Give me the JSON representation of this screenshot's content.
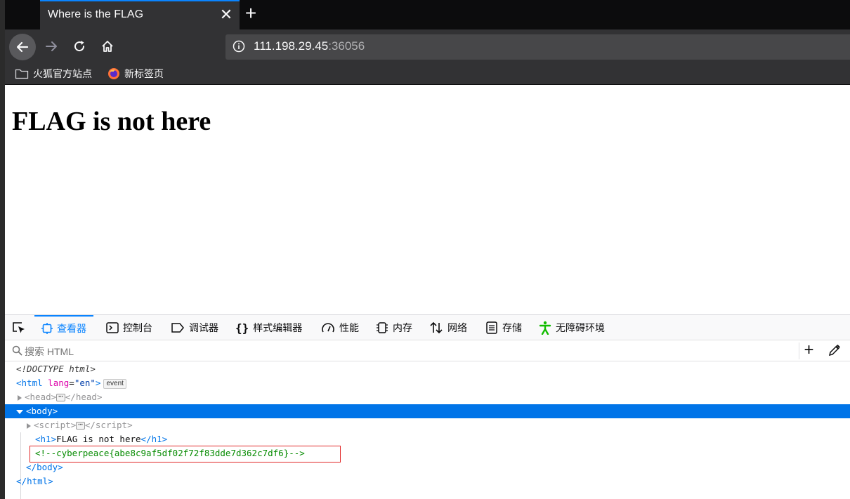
{
  "browser": {
    "tab_title": "Where is the FLAG",
    "tab_close": "✕",
    "new_tab": "+",
    "url_host": "111.198.29.45",
    "url_port": ":36056",
    "bookmarks": [
      {
        "label": "火狐官方站点",
        "icon": "folder-icon"
      },
      {
        "label": "新标签页",
        "icon": "firefox-icon"
      }
    ],
    "colors": {
      "chrome_dark": "#0c0c0d",
      "toolbar": "#323234",
      "accent": "#0a84ff"
    }
  },
  "page": {
    "heading": "FLAG is not here"
  },
  "devtools": {
    "tabs": [
      {
        "label": "查看器",
        "icon": "inspector-icon",
        "selected": true
      },
      {
        "label": "控制台",
        "icon": "console-icon"
      },
      {
        "label": "调试器",
        "icon": "debugger-icon"
      },
      {
        "label": "样式编辑器",
        "icon": "style-editor-icon"
      },
      {
        "label": "性能",
        "icon": "performance-icon"
      },
      {
        "label": "内存",
        "icon": "memory-icon"
      },
      {
        "label": "网络",
        "icon": "network-icon"
      },
      {
        "label": "存储",
        "icon": "storage-icon"
      },
      {
        "label": "无障碍环境",
        "icon": "accessibility-icon"
      }
    ],
    "search_placeholder": "搜索 HTML",
    "markup": {
      "doctype": "<!DOCTYPE html>",
      "html_open_tag": "html",
      "html_attr_name": "lang",
      "html_attr_value": "\"en\"",
      "event_badge": "event",
      "head_tag": "head",
      "body_tag": "body",
      "script_tag": "script",
      "h1_tag": "h1",
      "h1_text": "FLAG is not here",
      "comment": "<!--cyberpeace{abe8c9af5df02f72f83dde7d362c7df6}-->",
      "ellipsis": "⋯"
    }
  }
}
